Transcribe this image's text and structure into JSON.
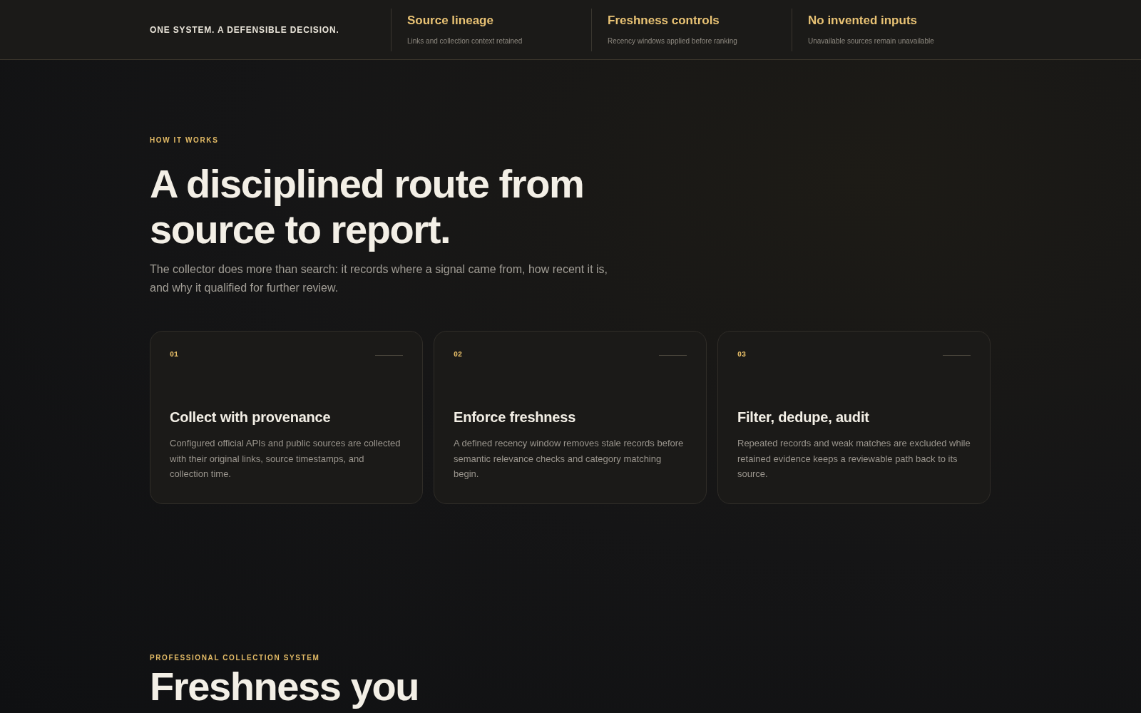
{
  "top_bar": {
    "tagline": "ONE SYSTEM. A DEFENSIBLE DECISION.",
    "highlights": [
      {
        "title": "Source lineage",
        "subtitle": "Links and collection context retained"
      },
      {
        "title": "Freshness controls",
        "subtitle": "Recency windows applied before ranking"
      },
      {
        "title": "No invented inputs",
        "subtitle": "Unavailable sources remain unavailable"
      }
    ]
  },
  "how_it_works": {
    "eyebrow": "HOW IT WORKS",
    "heading": "A disciplined route from source to report.",
    "description": "The collector does more than search: it records where a signal came from, how recent it is, and why it qualified for further review.",
    "steps": [
      {
        "number": "01",
        "title": "Collect with provenance",
        "description": "Configured official APIs and public sources are collected with their original links, source timestamps, and collection time."
      },
      {
        "number": "02",
        "title": "Enforce freshness",
        "description": "A defined recency window removes stale records before semantic relevance checks and category matching begin."
      },
      {
        "number": "03",
        "title": "Filter, dedupe, audit",
        "description": "Repeated records and weak matches are excluded while retained evidence keeps a reviewable path back to its source."
      }
    ]
  },
  "next_section": {
    "eyebrow": "PROFESSIONAL COLLECTION SYSTEM",
    "heading": "Freshness you"
  }
}
